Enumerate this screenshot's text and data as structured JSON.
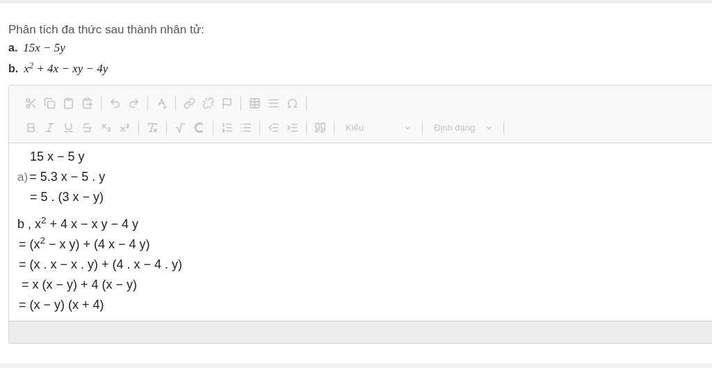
{
  "question": {
    "title": "Phân tích đa thức sau thành nhân tử:",
    "items": [
      {
        "label": "a.",
        "math": "15x − 5y"
      },
      {
        "label": "b.",
        "math": "x$^{2}$ + 4x − xy − 4y"
      }
    ]
  },
  "toolbar": {
    "disabled": true,
    "styles_label": "Kiểu",
    "format_label": "Định dạng"
  },
  "answer": {
    "blocks": [
      {
        "lines": [
          {
            "text": "15 x − 5 y"
          },
          {
            "prefix": "a)",
            "text": "= 5.3 x − 5 . y"
          },
          {
            "text": "= 5 . (3 x − y)"
          }
        ]
      },
      {
        "lines": [
          {
            "text": "b , x$^{2}$ + 4 x − x y − 4 y"
          },
          {
            "text": "= (x$^{2}$ − x y) + (4 x − 4 y)"
          },
          {
            "text": "= (x . x − x . y) + (4 . x − 4 . y)"
          },
          {
            "text": "= x (x − y) + 4 (x − y)"
          },
          {
            "text": "= (x − y) (x + 4)"
          }
        ]
      }
    ]
  }
}
